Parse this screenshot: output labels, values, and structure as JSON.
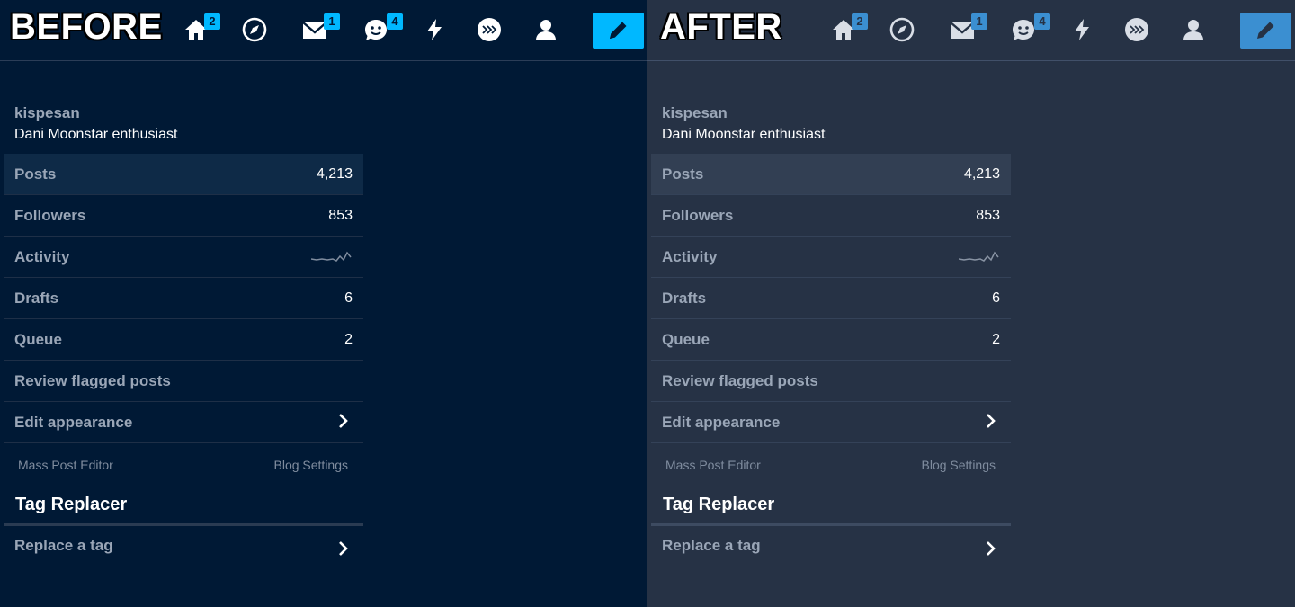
{
  "panels": [
    {
      "id": "before",
      "label": "BEFORE",
      "nav": {
        "home_badge": "2",
        "inbox_badge": "1",
        "messages_badge": "4"
      },
      "blog": {
        "name": "kispesan",
        "description": "Dani Moonstar enthusiast"
      },
      "rows": [
        {
          "label": "Posts",
          "value": "4,213"
        },
        {
          "label": "Followers",
          "value": "853"
        },
        {
          "label": "Activity",
          "value": ""
        },
        {
          "label": "Drafts",
          "value": "6"
        },
        {
          "label": "Queue",
          "value": "2"
        },
        {
          "label": "Review flagged posts",
          "value": ""
        },
        {
          "label": "Edit appearance",
          "value": ""
        }
      ],
      "links": {
        "left": "Mass Post Editor",
        "right": "Blog Settings"
      },
      "section": {
        "title": "Tag Replacer",
        "item": "Replace a tag"
      }
    },
    {
      "id": "after",
      "label": "AFTER",
      "nav": {
        "home_badge": "2",
        "inbox_badge": "1",
        "messages_badge": "4"
      },
      "blog": {
        "name": "kispesan",
        "description": "Dani Moonstar enthusiast"
      },
      "rows": [
        {
          "label": "Posts",
          "value": "4,213"
        },
        {
          "label": "Followers",
          "value": "853"
        },
        {
          "label": "Activity",
          "value": ""
        },
        {
          "label": "Drafts",
          "value": "6"
        },
        {
          "label": "Queue",
          "value": "2"
        },
        {
          "label": "Review flagged posts",
          "value": ""
        },
        {
          "label": "Edit appearance",
          "value": ""
        }
      ],
      "links": {
        "left": "Mass Post Editor",
        "right": "Blog Settings"
      },
      "section": {
        "title": "Tag Replacer",
        "item": "Replace a tag"
      }
    }
  ],
  "colors": {
    "before_bg": "#001935",
    "after_bg": "#263245",
    "before_accent": "#00b8ff",
    "after_accent": "#3b8fd1"
  },
  "icons": [
    "home-icon",
    "compass-icon",
    "mail-icon",
    "chat-icon",
    "lightning-icon",
    "store-icon",
    "account-icon",
    "pencil-icon",
    "sparkline-icon",
    "chevron-right-icon"
  ]
}
